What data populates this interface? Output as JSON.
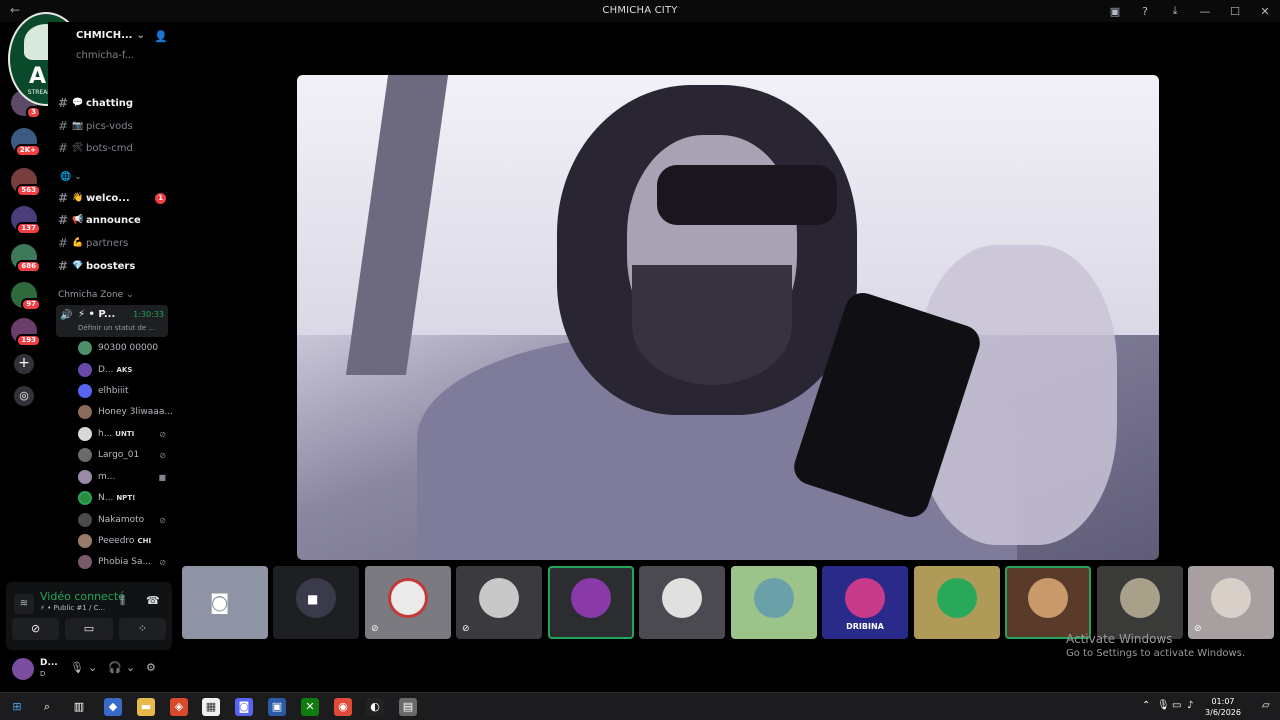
{
  "window": {
    "title": "CHMICHA CITY",
    "back": "←"
  },
  "server": {
    "name": "CHMICH...",
    "top_channel": "chmicha-f..."
  },
  "logo": {
    "text": "AK",
    "sub": "STREAMERS"
  },
  "servers": {
    "badges": [
      "3",
      "2K+",
      "563",
      "137",
      "686",
      "97",
      "193"
    ]
  },
  "channels": [
    {
      "name": "chatting",
      "emoji": "💬",
      "unread": true
    },
    {
      "name": "pics-vods",
      "emoji": "📷",
      "unread": false
    },
    {
      "name": "bots-cmd",
      "emoji": "🛠",
      "unread": false
    },
    {
      "name": "welco...",
      "emoji": "👋",
      "unread": true,
      "mention": "1"
    },
    {
      "name": "announce",
      "emoji": "📢",
      "unread": true
    },
    {
      "name": "partners",
      "emoji": "💪",
      "unread": false
    },
    {
      "name": "boosters",
      "emoji": "💎",
      "unread": true
    }
  ],
  "category": {
    "name": "Chmicha Zone"
  },
  "voice_channel": {
    "name": "P...",
    "time": "1:30:33",
    "status": "Définir un statut de ..."
  },
  "voice_users": [
    {
      "name": "90300 00000",
      "tag": ""
    },
    {
      "name": "D...",
      "tag": "AKS"
    },
    {
      "name": "elhbiiit",
      "tag": ""
    },
    {
      "name": "Honey 3liwaaa...",
      "tag": ""
    },
    {
      "name": "h...",
      "tag": "UNTI"
    },
    {
      "name": "Largo_01",
      "tag": ""
    },
    {
      "name": "m...",
      "tag": ""
    },
    {
      "name": "N...",
      "tag": "NPT!"
    },
    {
      "name": "Nakamoto",
      "tag": ""
    },
    {
      "name": "Peeedro",
      "tag": "CHI"
    },
    {
      "name": "Phobia Sa...",
      "tag": ""
    }
  ],
  "rtc": {
    "label": "Vidéo connecté",
    "sub": "⚡ • Public #1 / C..."
  },
  "user": {
    "name": "D...",
    "status": "D"
  },
  "watermark": {
    "line1": "Activate Windows",
    "line2": "Go to Settings to activate Windows."
  },
  "clock": {
    "time": "01:07",
    "date": "3/6/2026"
  },
  "tiles": [
    {
      "bg": "#8e94a3",
      "type": "discord"
    },
    {
      "bg": "#1e1f22",
      "type": "cam"
    },
    {
      "bg": "#7a7a80",
      "type": "muted"
    },
    {
      "bg": "#3a3a3f",
      "type": "muted"
    },
    {
      "bg": "#2b2d31",
      "type": "speaking"
    },
    {
      "bg": "#4a4a50",
      "type": "normal"
    },
    {
      "bg": "#9cc48a",
      "type": "normal"
    },
    {
      "bg": "#2a2a8a",
      "type": "normal",
      "label": "DRIBINA"
    },
    {
      "bg": "#b09a58",
      "type": "normal"
    },
    {
      "bg": "#5a3a2a",
      "type": "speaking"
    },
    {
      "bg": "#3a3a38",
      "type": "normal"
    },
    {
      "bg": "#a8a0a0",
      "type": "muted"
    }
  ]
}
